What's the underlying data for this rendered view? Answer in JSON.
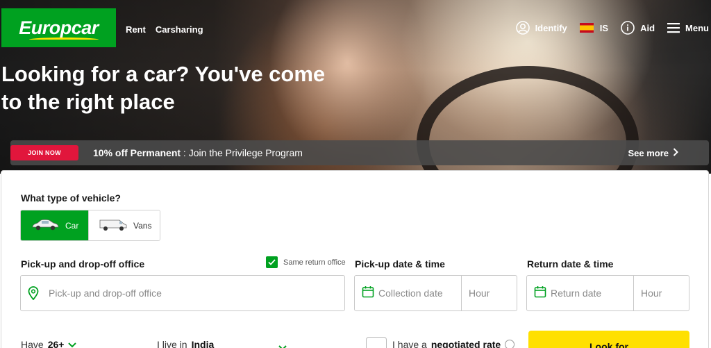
{
  "header": {
    "logo_text": "Europcar",
    "nav_left": [
      "Rent",
      "Carsharing"
    ],
    "identify_label": "Identify",
    "language_label": "IS",
    "aid_label": "Aid",
    "menu_label": "Menu"
  },
  "hero": {
    "headline_line1": "Looking for a car? You've come",
    "headline_line2": "to the right place"
  },
  "promo": {
    "join_label": "JOIN NOW",
    "bold_text": "10% off Permanent",
    "text": " : Join the Privilege Program",
    "see_more_label": "See more"
  },
  "form": {
    "vehicle_type_label": "What type of vehicle?",
    "vehicle_options": [
      {
        "label": "Car",
        "selected": true
      },
      {
        "label": "Vans",
        "selected": false
      }
    ],
    "pickup_office_label": "Pick-up and drop-off office",
    "same_return_office_label": "Same return office",
    "same_return_office_checked": true,
    "pickup_office_placeholder": "Pick-up and drop-off office",
    "pickup_datetime_label": "Pick-up date & time",
    "collection_date_placeholder": "Collection date",
    "pickup_hour_placeholder": "Hour",
    "return_datetime_label": "Return date & time",
    "return_date_placeholder": "Return date",
    "return_hour_placeholder": "Hour",
    "age_prefix": "Have",
    "age_value": "26+",
    "live_in_prefix": "I live in",
    "live_in_value": "India",
    "negotiated_prefix": "I have a",
    "negotiated_bold": "negotiated rate",
    "submit_label": "Look for"
  },
  "colors": {
    "brand_green": "#00a120",
    "accent_yellow": "#ffe000",
    "join_red": "#e1163c"
  }
}
